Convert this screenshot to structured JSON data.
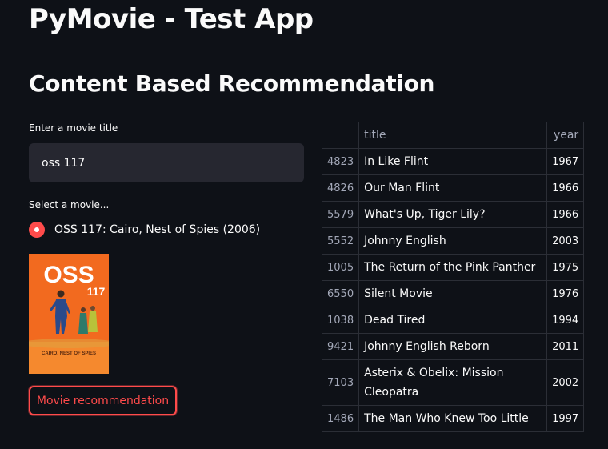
{
  "app": {
    "title": "PyMovie - Test App"
  },
  "section": {
    "title": "Content Based Recommendation"
  },
  "search": {
    "label": "Enter a movie title",
    "value": "oss 117"
  },
  "select": {
    "label": "Select a movie...",
    "option": "OSS 117: Cairo, Nest of Spies (2006)"
  },
  "poster": {
    "logo_text": "OSS",
    "logo_number": "117",
    "tagline": "CAIRO, NEST OF SPIES",
    "background_color": "#f26a1f"
  },
  "button": {
    "label": "Movie recommendation"
  },
  "table": {
    "columns": [
      "",
      "title",
      "year"
    ],
    "rows": [
      {
        "index": "4823",
        "title": "In Like Flint",
        "year": "1967"
      },
      {
        "index": "4826",
        "title": "Our Man Flint",
        "year": "1966"
      },
      {
        "index": "5579",
        "title": "What's Up, Tiger Lily?",
        "year": "1966"
      },
      {
        "index": "5552",
        "title": "Johnny English",
        "year": "2003"
      },
      {
        "index": "1005",
        "title": "The Return of the Pink Panther",
        "year": "1975"
      },
      {
        "index": "6550",
        "title": "Silent Movie",
        "year": "1976"
      },
      {
        "index": "1038",
        "title": "Dead Tired",
        "year": "1994"
      },
      {
        "index": "9421",
        "title": "Johnny English Reborn",
        "year": "2011"
      },
      {
        "index": "7103",
        "title": "Asterix & Obelix: Mission Cleopatra",
        "year": "2002"
      },
      {
        "index": "1486",
        "title": "The Man Who Knew Too Little",
        "year": "1997"
      }
    ]
  },
  "colors": {
    "background": "#0e1117",
    "accent": "#ff4b4b",
    "input_bg": "#262730"
  }
}
